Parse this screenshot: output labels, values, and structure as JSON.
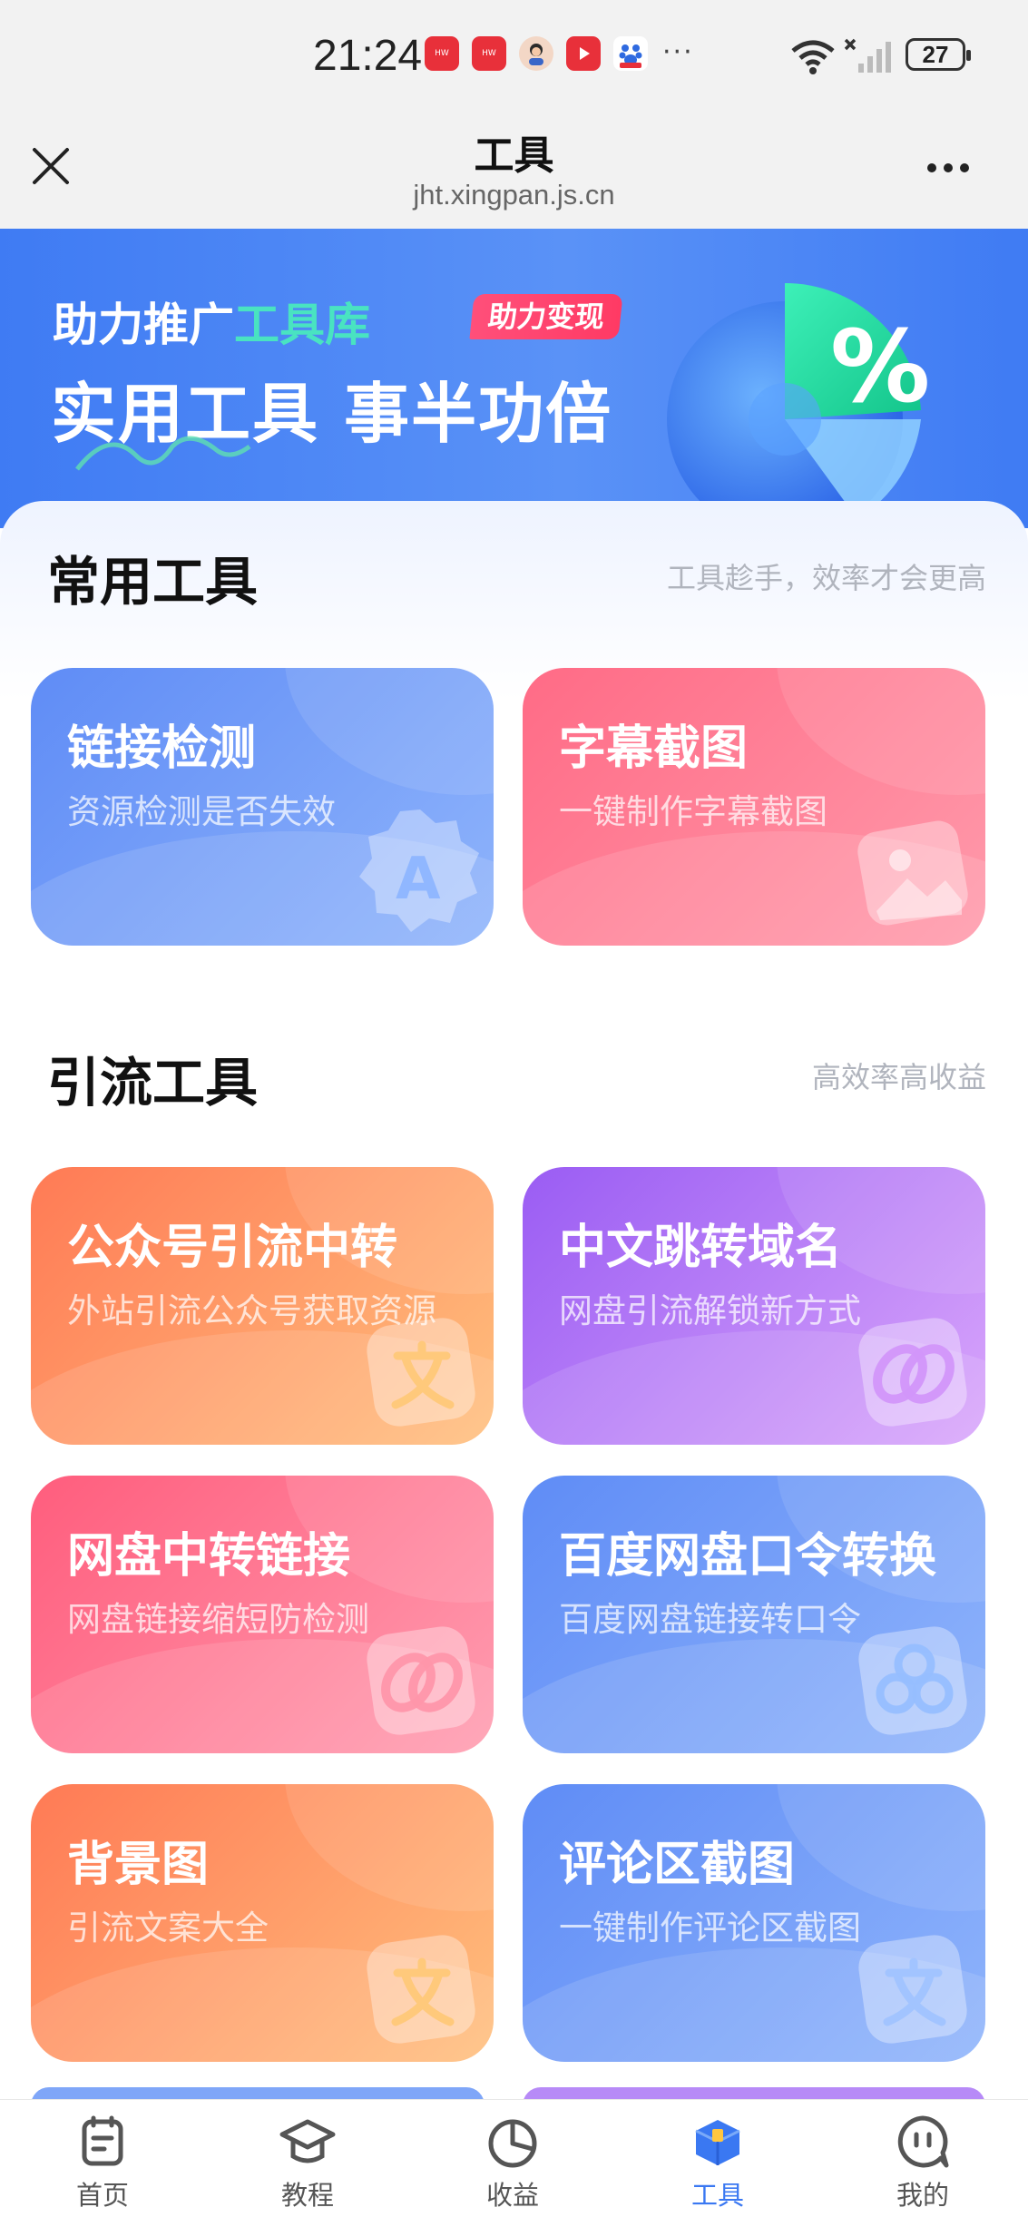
{
  "status_bar": {
    "time": "21:24",
    "battery": "27",
    "more": "···",
    "notification_icons": [
      "huawei-app-icon",
      "huawei-app-icon",
      "avatar-app-icon",
      "video-app-icon",
      "baidu-app-icon"
    ]
  },
  "title_bar": {
    "title": "工具",
    "url": "jht.xingpan.js.cn"
  },
  "banner": {
    "line1_prefix": "助力推广",
    "line1_highlight": "工具库",
    "tag": "助力变现",
    "line2": "实用工具  事半功倍"
  },
  "sections": [
    {
      "title": "常用工具",
      "subtitle": "工具趁手，效率才会更高",
      "cards": [
        {
          "title": "链接检测",
          "subtitle": "资源检测是否失效",
          "icon": "letter-a-badge-icon",
          "color": "blue"
        },
        {
          "title": "字幕截图",
          "subtitle": "一键制作字幕截图",
          "icon": "image-icon",
          "color": "pink"
        }
      ]
    },
    {
      "title": "引流工具",
      "subtitle": "高效率高收益",
      "cards": [
        {
          "title": "公众号引流中转",
          "subtitle": "外站引流公众号获取资源",
          "icon": "translate-icon",
          "color": "orange"
        },
        {
          "title": "中文跳转域名",
          "subtitle": "网盘引流解锁新方式",
          "icon": "link-icon",
          "color": "purple"
        },
        {
          "title": "网盘中转链接",
          "subtitle": "网盘链接缩短防检测",
          "icon": "link-icon",
          "color": "rose"
        },
        {
          "title": "百度网盘口令转换",
          "subtitle": "百度网盘链接转口令",
          "icon": "cloud-icon",
          "color": "blue"
        },
        {
          "title": "背景图",
          "subtitle": "引流文案大全",
          "icon": "translate-icon",
          "color": "orange"
        },
        {
          "title": "评论区截图",
          "subtitle": "一键制作评论区截图",
          "icon": "translate-icon",
          "color": "blue"
        }
      ]
    }
  ],
  "tab_bar": {
    "items": [
      {
        "label": "首页",
        "icon": "home-notes-icon",
        "active": false
      },
      {
        "label": "教程",
        "icon": "graduation-cap-icon",
        "active": false
      },
      {
        "label": "收益",
        "icon": "pie-chart-icon",
        "active": false
      },
      {
        "label": "工具",
        "icon": "toolbox-icon",
        "active": true
      },
      {
        "label": "我的",
        "icon": "chat-face-icon",
        "active": false
      }
    ]
  },
  "colors": {
    "accent": "#3a78f2",
    "banner_blue": "#4a82f5",
    "highlight_teal": "#49e3c1",
    "tag_pink": "#ff4f7a"
  }
}
